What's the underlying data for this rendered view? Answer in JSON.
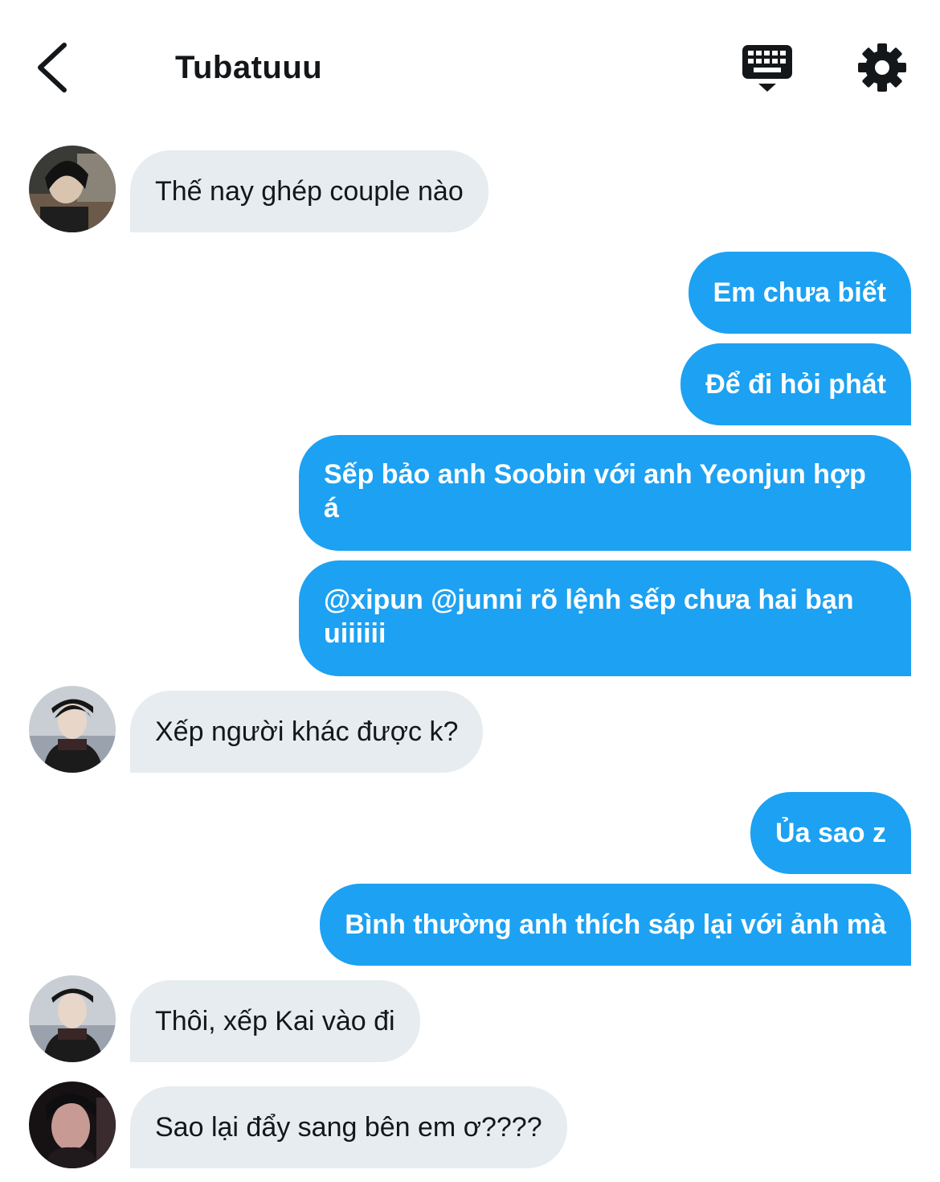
{
  "conversation": {
    "title": "Tubatuuu"
  },
  "icons": {
    "back": "chevron-left-icon",
    "keyboard": "keyboard-icon",
    "settings": "gear-icon"
  },
  "colors": {
    "outgoing_bubble": "#1da1f2",
    "incoming_bubble": "#e6ecf0"
  },
  "messages": [
    {
      "direction": "in",
      "text": "Thế nay ghép couple nào"
    },
    {
      "direction": "out",
      "text": "Em chưa biết"
    },
    {
      "direction": "out",
      "text": "Để đi hỏi phát"
    },
    {
      "direction": "out",
      "text": "Sếp bảo anh Soobin với anh Yeonjun hợp á"
    },
    {
      "direction": "out",
      "text": "@xipun @junni rõ lệnh sếp chưa hai bạn uiiiiii"
    },
    {
      "direction": "in",
      "text": "Xếp người khác được k?"
    },
    {
      "direction": "out",
      "text": "Ủa sao z"
    },
    {
      "direction": "out",
      "text": "Bình thường anh thích sáp lại với ảnh mà"
    },
    {
      "direction": "in",
      "text": "Thôi, xếp Kai vào đi"
    },
    {
      "direction": "in",
      "text": "Sao lại đẩy sang bên em ơ????"
    }
  ]
}
